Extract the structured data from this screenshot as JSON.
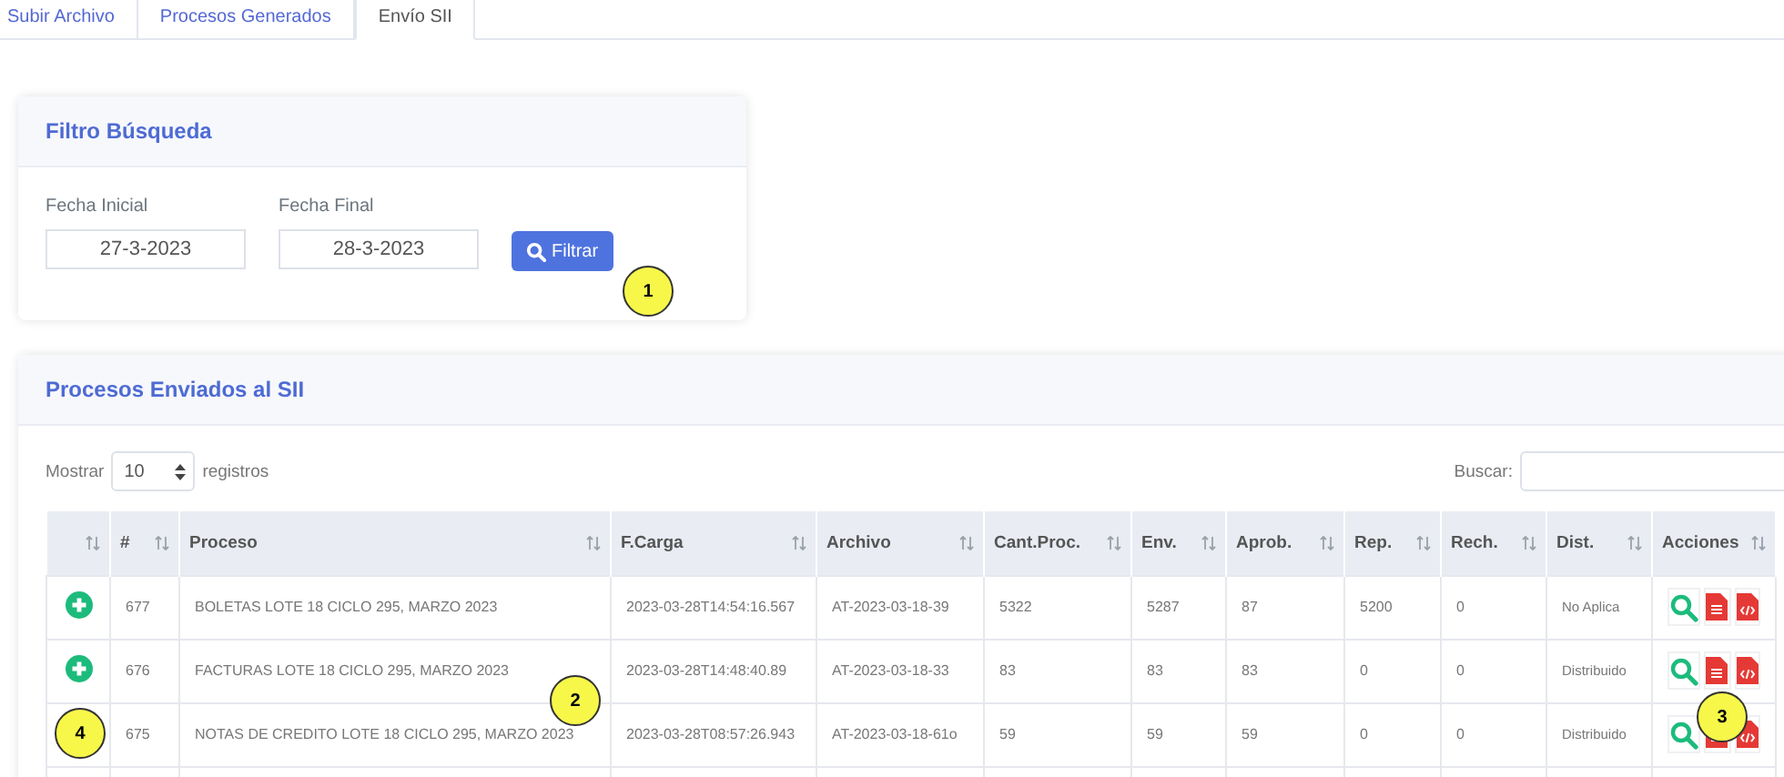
{
  "tabs": [
    {
      "label": "Subir Archivo",
      "selected": false
    },
    {
      "label": "Procesos Generados",
      "selected": false
    },
    {
      "label": "Envío SII",
      "selected": true
    }
  ],
  "filter": {
    "title": "Filtro Búsqueda",
    "start_label": "Fecha Inicial",
    "start_value": "27-3-2023",
    "end_label": "Fecha Final",
    "end_value": "28-3-2023",
    "button": "Filtrar"
  },
  "table_card": {
    "title": "Procesos Enviados al SII",
    "show_label": "Mostrar",
    "show_value": "10",
    "show_suffix": "registros",
    "search_label": "Buscar:"
  },
  "table": {
    "columns": [
      "",
      "#",
      "Proceso",
      "F.Carga",
      "Archivo",
      "Cant.Proc.",
      "Env.",
      "Aprob.",
      "Rep.",
      "Rech.",
      "Dist.",
      "Acciones"
    ],
    "rows": [
      {
        "expandable": true,
        "cells": [
          "",
          "677",
          "BOLETAS LOTE 18 CICLO 295, MARZO 2023",
          "2023-03-28T14:54:16.567",
          "AT-2023-03-18-39",
          "5322",
          "5287",
          "87",
          "5200",
          "0",
          "No Aplica"
        ]
      },
      {
        "expandable": true,
        "cells": [
          "",
          "676",
          "FACTURAS LOTE 18 CICLO 295, MARZO 2023",
          "2023-03-28T14:48:40.89",
          "AT-2023-03-18-33",
          "83",
          "83",
          "83",
          "0",
          "0",
          "Distribuido"
        ]
      },
      {
        "expandable": false,
        "cells": [
          "",
          "675",
          "NOTAS DE CREDITO LOTE 18 CICLO 295, MARZO 2023",
          "2023-03-28T08:57:26.943",
          "AT-2023-03-18-61o",
          "59",
          "59",
          "59",
          "0",
          "0",
          "Distribuido"
        ]
      }
    ]
  },
  "callouts": [
    "1",
    "2",
    "3",
    "4"
  ]
}
